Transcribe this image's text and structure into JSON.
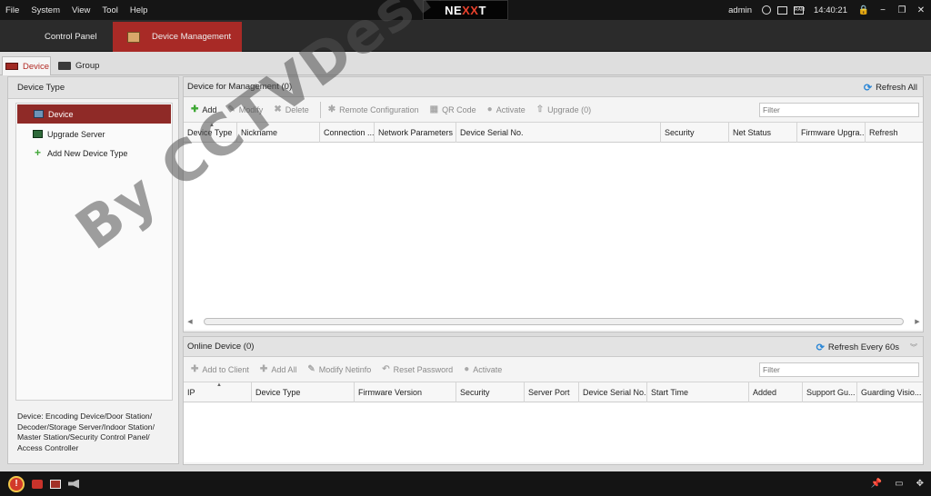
{
  "menubar": {
    "menus": [
      "File",
      "System",
      "View",
      "Tool",
      "Help"
    ],
    "brand_left": "NE",
    "brand_mid": "XX",
    "brand_right": "T",
    "user": "admin",
    "time": "14:40:21",
    "ram_label": "RAM",
    "icons": [
      "globe-icon",
      "keyboard-icon",
      "ram-icon",
      "lock-icon"
    ],
    "window_controls": [
      "minimize-icon",
      "restore-icon",
      "close-icon"
    ]
  },
  "modules": {
    "control_panel": "Control Panel",
    "device_management": "Device Management"
  },
  "subtabs": {
    "device": "Device",
    "group": "Group"
  },
  "left": {
    "title": "Device Type",
    "items": [
      {
        "label": "Device",
        "icon": "device-icon"
      },
      {
        "label": "Upgrade Server",
        "icon": "server-icon"
      },
      {
        "label": "Add New Device Type",
        "icon": "plus-icon"
      }
    ],
    "description": "Device: Encoding Device/Door Station/ Decoder/Storage Server/Indoor Station/ Master Station/Security Control Panel/ Access Controller"
  },
  "management": {
    "title": "Device for Management (0)",
    "refresh_all": "Refresh All",
    "toolbar": {
      "add": "Add",
      "modify": "Modify",
      "delete": "Delete",
      "remote_config": "Remote Configuration",
      "qr_code": "QR Code",
      "activate": "Activate",
      "upgrade": "Upgrade (0)"
    },
    "filter_placeholder": "Filter",
    "columns": [
      "Device Type",
      "Nickname",
      "Connection ...",
      "Network Parameters",
      "Device Serial No.",
      "Security",
      "Net Status",
      "Firmware Upgra...",
      "Refresh"
    ]
  },
  "online": {
    "title": "Online Device (0)",
    "refresh": "Refresh Every 60s",
    "toolbar": {
      "add_to_client": "Add to Client",
      "add_all": "Add All",
      "modify_netinfo": "Modify Netinfo",
      "reset_password": "Reset Password",
      "activate": "Activate"
    },
    "filter_placeholder": "Filter",
    "columns": [
      "IP",
      "Device Type",
      "Firmware Version",
      "Security",
      "Server Port",
      "Device Serial No.",
      "Start Time",
      "Added",
      "Support Gu...",
      "Guarding Visio..."
    ]
  },
  "watermark": "By CCTVDesk",
  "colors": {
    "accent_red": "#a82a26",
    "selected_row": "#8f2a27",
    "link_blue": "#2a86d6",
    "add_green": "#3fa835"
  }
}
